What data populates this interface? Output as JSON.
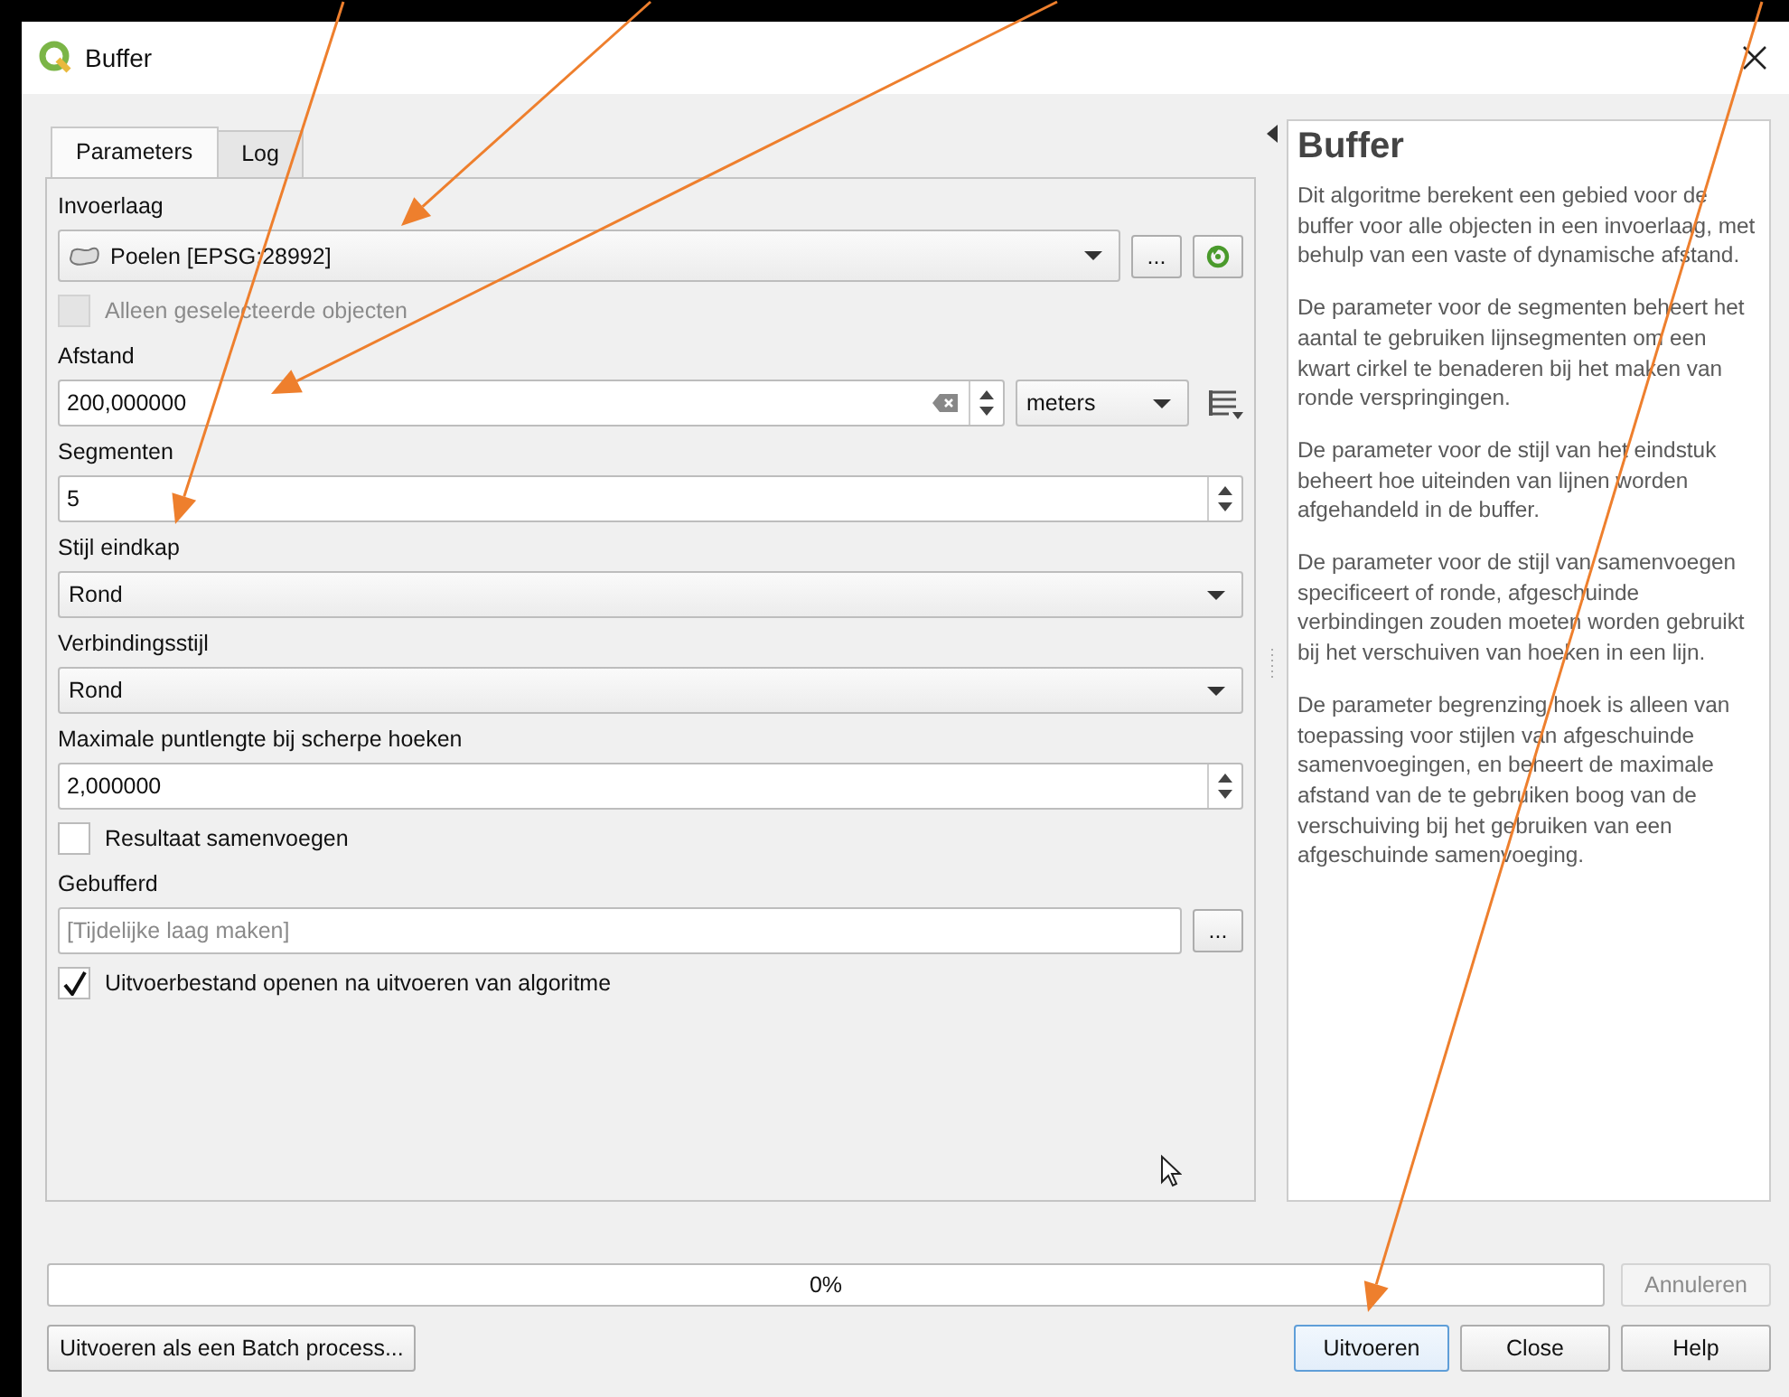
{
  "window": {
    "title": "Buffer"
  },
  "tabs": [
    {
      "label": "Parameters",
      "selected": true
    },
    {
      "label": "Log",
      "selected": false
    }
  ],
  "parameters": [
    {
      "kind": "layer",
      "label": "Invoerlaag",
      "value": "Poelen [EPSG:28992]",
      "browse": "..."
    },
    {
      "kind": "checkbox",
      "label": "Alleen geselecteerde objecten",
      "checked": false,
      "disabled": true
    },
    {
      "kind": "distance",
      "label": "Afstand",
      "value": "200,000000",
      "unit": "meters"
    },
    {
      "kind": "spin",
      "label": "Segmenten",
      "value": "5"
    },
    {
      "kind": "select",
      "label": "Stijl eindkap",
      "value": "Rond"
    },
    {
      "kind": "select",
      "label": "Verbindingsstijl",
      "value": "Rond"
    },
    {
      "kind": "spin",
      "label": "Maximale puntlengte bij scherpe hoeken",
      "value": "2,000000"
    },
    {
      "kind": "checkbox",
      "label": "Resultaat samenvoegen",
      "checked": false,
      "disabled": false
    },
    {
      "kind": "output",
      "label": "Gebufferd",
      "placeholder": "[Tijdelijke laag maken]",
      "browse": "..."
    },
    {
      "kind": "checkbox",
      "label": "Uitvoerbestand openen na uitvoeren van algoritme",
      "checked": true,
      "disabled": false
    }
  ],
  "help": {
    "title": "Buffer",
    "paragraphs": [
      "Dit algoritme berekent een gebied voor de buffer voor alle objecten in een invoerlaag, met behulp van een vaste of dynamische afstand.",
      "De parameter voor de segmenten beheert het aantal te gebruiken lijnsegmenten om een kwart cirkel te benaderen bij het maken van ronde verspringingen.",
      "De parameter voor de stijl van het eindstuk beheert hoe uiteinden van lijnen worden afgehandeld in de buffer.",
      "De parameter voor de stijl van samenvoegen specificeert of ronde, afgeschuinde verbindingen zouden moeten worden gebruikt bij het verschuiven van hoeken in een lijn.",
      "De parameter begrenzing hoek is alleen van toepassing voor stijlen van afgeschuinde samenvoegingen, en beheert de maximale afstand van de te gebruiken boog van de verschuiving bij het gebruiken van een afgeschuinde samenvoeging."
    ]
  },
  "progress": {
    "level": 0,
    "text": "0%"
  },
  "cancel": {
    "label": "Annuleren",
    "disabled": true
  },
  "batch_button": {
    "label": "Uitvoeren als een Batch process..."
  },
  "buttons": [
    {
      "label": "Uitvoeren",
      "default": true
    },
    {
      "label": "Close",
      "default": false
    },
    {
      "label": "Help",
      "default": false
    }
  ]
}
